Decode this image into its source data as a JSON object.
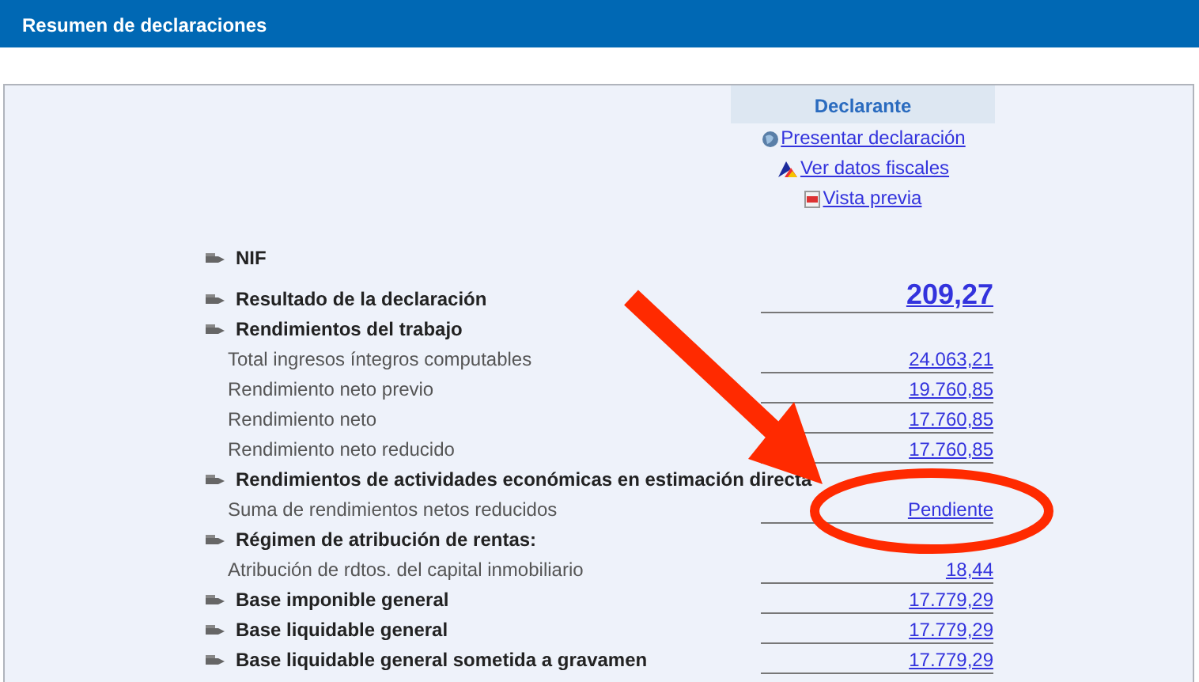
{
  "header": {
    "title": "Resumen de declaraciones"
  },
  "declarante": {
    "title": "Declarante",
    "links": [
      {
        "label": "Presentar declaración",
        "kind": "globe"
      },
      {
        "label": "Ver datos fiscales",
        "kind": "logo"
      },
      {
        "label": "Vista previa",
        "kind": "document"
      }
    ]
  },
  "rows": [
    {
      "kind": "section",
      "label": "NIF"
    },
    {
      "kind": "total",
      "label": "Resultado de la declaración",
      "value": "209,27"
    },
    {
      "kind": "section",
      "label": "Rendimientos del trabajo"
    },
    {
      "kind": "item",
      "label": "Total ingresos íntegros computables",
      "value": "24.063,21"
    },
    {
      "kind": "item",
      "label": "Rendimiento neto previo",
      "value": "19.760,85"
    },
    {
      "kind": "item",
      "label": "Rendimiento neto",
      "value": "17.760,85"
    },
    {
      "kind": "item",
      "label": "Rendimiento neto reducido",
      "value": "17.760,85"
    },
    {
      "kind": "section",
      "label": "Rendimientos de actividades económicas en estimación directa"
    },
    {
      "kind": "item",
      "label": "Suma de rendimientos netos reducidos",
      "value": "Pendiente"
    },
    {
      "kind": "section",
      "label": "Régimen de atribución de rentas:"
    },
    {
      "kind": "item",
      "label": "Atribución de rdtos. del capital inmobiliario",
      "value": "18,44"
    },
    {
      "kind": "section",
      "label": "Base imponible general",
      "value": "17.779,29"
    },
    {
      "kind": "section",
      "label": "Base liquidable general",
      "value": "17.779,29"
    },
    {
      "kind": "section",
      "label": "Base liquidable general sometida a gravamen",
      "value": "17.779,29"
    }
  ]
}
